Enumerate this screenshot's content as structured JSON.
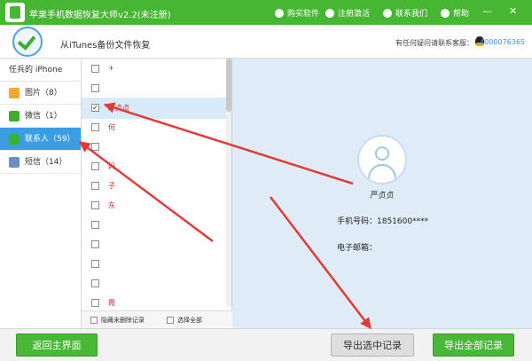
{
  "titlebar": {
    "title": "苹果手机数据恢复大师v2.2(未注册)",
    "buy": "购买软件",
    "register": "注册激活",
    "contact": "联系我们",
    "help": "帮助",
    "minimize": "—",
    "close": "✕"
  },
  "header": {
    "breadcrumb": "从iTunes备份文件恢复",
    "help_text": "有任何疑问请联系客服：",
    "qq": "4000076365"
  },
  "sidebar": {
    "device": "任兵的 iPhone",
    "items": [
      {
        "label": "图片（8）",
        "icon": "photos-icon",
        "color": "#f0a830"
      },
      {
        "label": "微信（1）",
        "icon": "wechat-icon",
        "color": "#3fae2f"
      },
      {
        "label": "联系人（59）",
        "icon": "contacts-icon",
        "color": "#37b233"
      },
      {
        "label": "短信（14）",
        "icon": "sms-icon",
        "color": "#6b8ec6"
      }
    ]
  },
  "list": {
    "rows": [
      {
        "name": "+",
        "checked": false,
        "selected": false
      },
      {
        "name": "",
        "checked": false,
        "selected": false
      },
      {
        "name": "严贞贞",
        "checked": true,
        "selected": true
      },
      {
        "name": "何",
        "checked": false,
        "selected": false
      },
      {
        "name": "",
        "checked": false,
        "selected": false
      },
      {
        "name": "妈",
        "checked": false,
        "selected": false
      },
      {
        "name": "子",
        "checked": false,
        "selected": false
      },
      {
        "name": "东",
        "checked": false,
        "selected": false
      },
      {
        "name": "",
        "checked": false,
        "selected": false
      },
      {
        "name": "",
        "checked": false,
        "selected": false
      },
      {
        "name": "",
        "checked": false,
        "selected": false
      },
      {
        "name": "",
        "checked": false,
        "selected": false
      },
      {
        "name": "霞",
        "checked": false,
        "selected": false
      }
    ],
    "hide_deleted": "隐藏未删除记录",
    "select_all": "选择全部"
  },
  "detail": {
    "name": "严贞贞",
    "phone": "手机号码：1851600****",
    "email": "电子邮箱："
  },
  "footer": {
    "back": "返回主界面",
    "export_selected": "导出选中记录",
    "export_all": "导出全部记录"
  },
  "colors": {
    "brand_green": "#46b633",
    "active_blue": "#3b9de3",
    "annotation_red": "#e23b36"
  }
}
